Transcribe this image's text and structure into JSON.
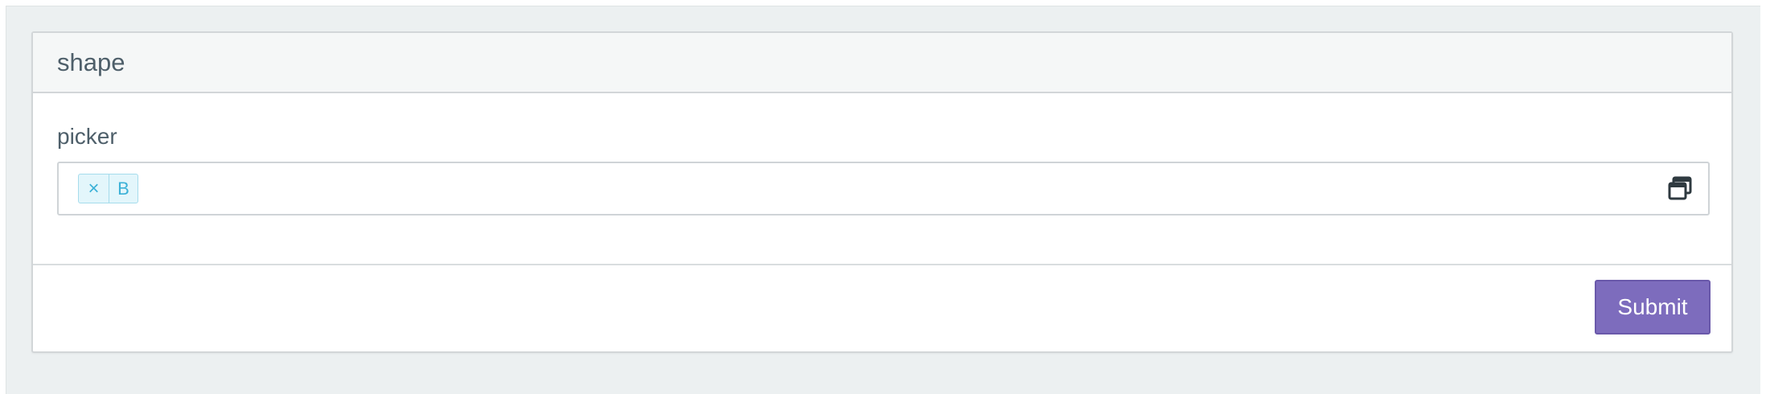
{
  "card": {
    "title": "shape"
  },
  "form": {
    "field_label": "picker",
    "picker": {
      "selected_tags": [
        {
          "remove_symbol": "×",
          "label": "B"
        }
      ],
      "icon": "window-restore-icon"
    },
    "submit_label": "Submit"
  },
  "colors": {
    "page_background": "#ecf0f1",
    "card_header_background": "#f5f7f7",
    "tag_background": "#e3f6fb",
    "tag_text": "#3bb1d7",
    "submit_background": "#7d6cbd",
    "text": "#4e5f6a"
  }
}
